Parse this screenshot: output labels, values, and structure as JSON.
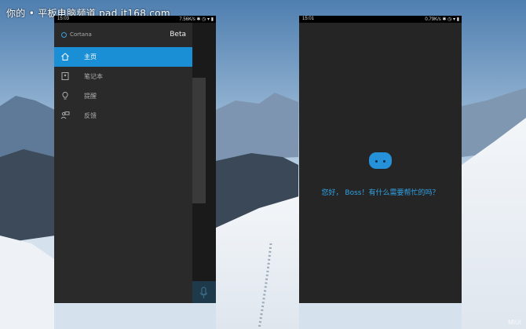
{
  "watermark": "你的 • 平板电脑频道 pad.it168.com",
  "corner_mark": "MIUI",
  "left_phone": {
    "status": {
      "time": "15:03",
      "speed": "7.56K/s"
    },
    "drawer": {
      "app_name": "Cortana",
      "badge": "Beta",
      "items": [
        {
          "label": "主页",
          "icon": "home-icon",
          "active": true
        },
        {
          "label": "笔记本",
          "icon": "notebook-icon",
          "active": false
        },
        {
          "label": "提醒",
          "icon": "lightbulb-icon",
          "active": false
        },
        {
          "label": "反馈",
          "icon": "feedback-icon",
          "active": false
        }
      ]
    }
  },
  "right_phone": {
    "status": {
      "time": "15:01",
      "speed": "0.79K/s"
    },
    "greeting": "您好， Boss！有什么需要帮忙的吗？"
  },
  "colors": {
    "accent": "#1a8fd6",
    "greeting": "#2fa3e6",
    "panel": "#2a2a2a"
  }
}
